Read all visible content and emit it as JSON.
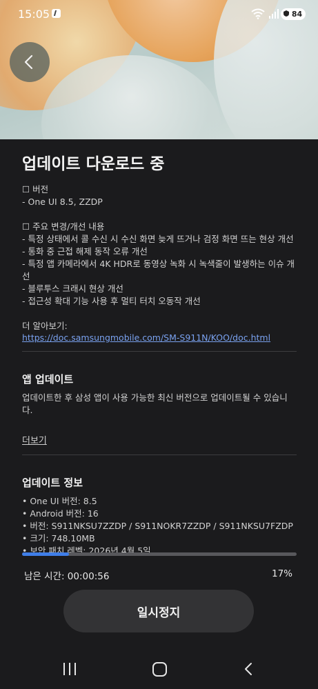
{
  "status_bar": {
    "time": "15:05",
    "battery": "84"
  },
  "header": {
    "title": "업데이트 다운로드 중"
  },
  "notes": {
    "text": "☐ 버전\n - One UI 8.5, ZZDP\n\n☐ 주요 변경/개선 내용\n- 특정 상태에서 콜 수신 시 수신 화면 늦게 뜨거나 검정 화면 뜨는 현상 개선\n- 통화 중 근접 해제 동작 오류 개선\n- 특정 앱 카메라에서 4K HDR로 동영상 녹화 시 녹색줄이 발생하는 이슈 개선\n- 블루투스 크래시 현상 개선\n- 접근성 확대 기능 사용 후 멀티 터치 오동작 개선\n\n더 알아보기:",
    "link": "https://doc.samsungmobile.com/SM-S911N/KOO/doc.html"
  },
  "app_update": {
    "title": "앱 업데이트",
    "body": "업데이트한 후 삼성 앱이 사용 가능한 최신 버전으로 업데이트될 수 있습니다.",
    "more": "더보기"
  },
  "update_info": {
    "title": "업데이트 정보",
    "items": [
      "• One UI 버전: 8.5",
      "• Android 버전: 16",
      "• 버전: S911NKSU7ZZDP / S911NOKR7ZZDP / S911NKSU7FZDP",
      "• 크기: 748.10MB",
      "• 보안 패치 레벨: 2026년 4월 5일"
    ]
  },
  "progress": {
    "remaining_label": "남은 시간: 00:00:56",
    "percent_label": "17%",
    "fraction": 0.17,
    "fill_color": "#3f7ee8"
  },
  "actions": {
    "pause_label": "일시정지"
  },
  "icons": [
    "back-arrow-icon",
    "wifi-icon",
    "signal-icon",
    "battery-icon",
    "app-notification-icon",
    "recent-apps-icon",
    "home-icon",
    "back-icon"
  ]
}
